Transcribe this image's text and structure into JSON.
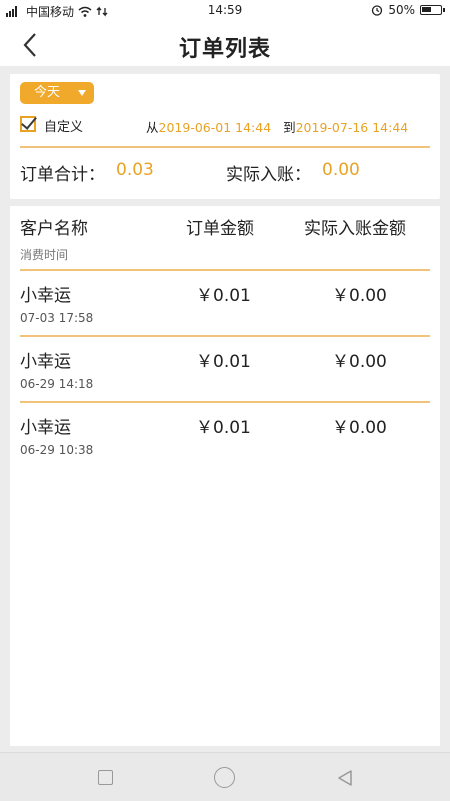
{
  "status_bar": {
    "carrier": "中国移动",
    "time": "14:59",
    "battery": "50%",
    "battery_level": 0.5
  },
  "nav": {
    "title": "订单列表",
    "back_icon": "chevron-left-icon"
  },
  "filter": {
    "period_label": "今天",
    "custom_label": "自定义",
    "custom_checked": true,
    "from_label": "从",
    "from_date": "2019-06-01 14:44",
    "to_label": "到",
    "to_date": "2019-07-16 14:44"
  },
  "totals": {
    "order_total_label": "订单合计：",
    "order_total_value": "0.03",
    "received_label": "实际入账：",
    "received_value": "0.00"
  },
  "table": {
    "col_customer": "客户名称",
    "col_order_amount": "订单金额",
    "col_received_amount": "实际入账金额",
    "sub_label": "消费时间",
    "rows": [
      {
        "name": "小幸运",
        "time": "07-03 17:58",
        "order_amount": "￥0.01",
        "received_amount": "￥0.00"
      },
      {
        "name": "小幸运",
        "time": "06-29 14:18",
        "order_amount": "￥0.01",
        "received_amount": "￥0.00"
      },
      {
        "name": "小幸运",
        "time": "06-29 10:38",
        "order_amount": "￥0.01",
        "received_amount": "￥0.00"
      }
    ]
  },
  "colors": {
    "accent": "#e8a325",
    "divider": "#f0c27a"
  }
}
